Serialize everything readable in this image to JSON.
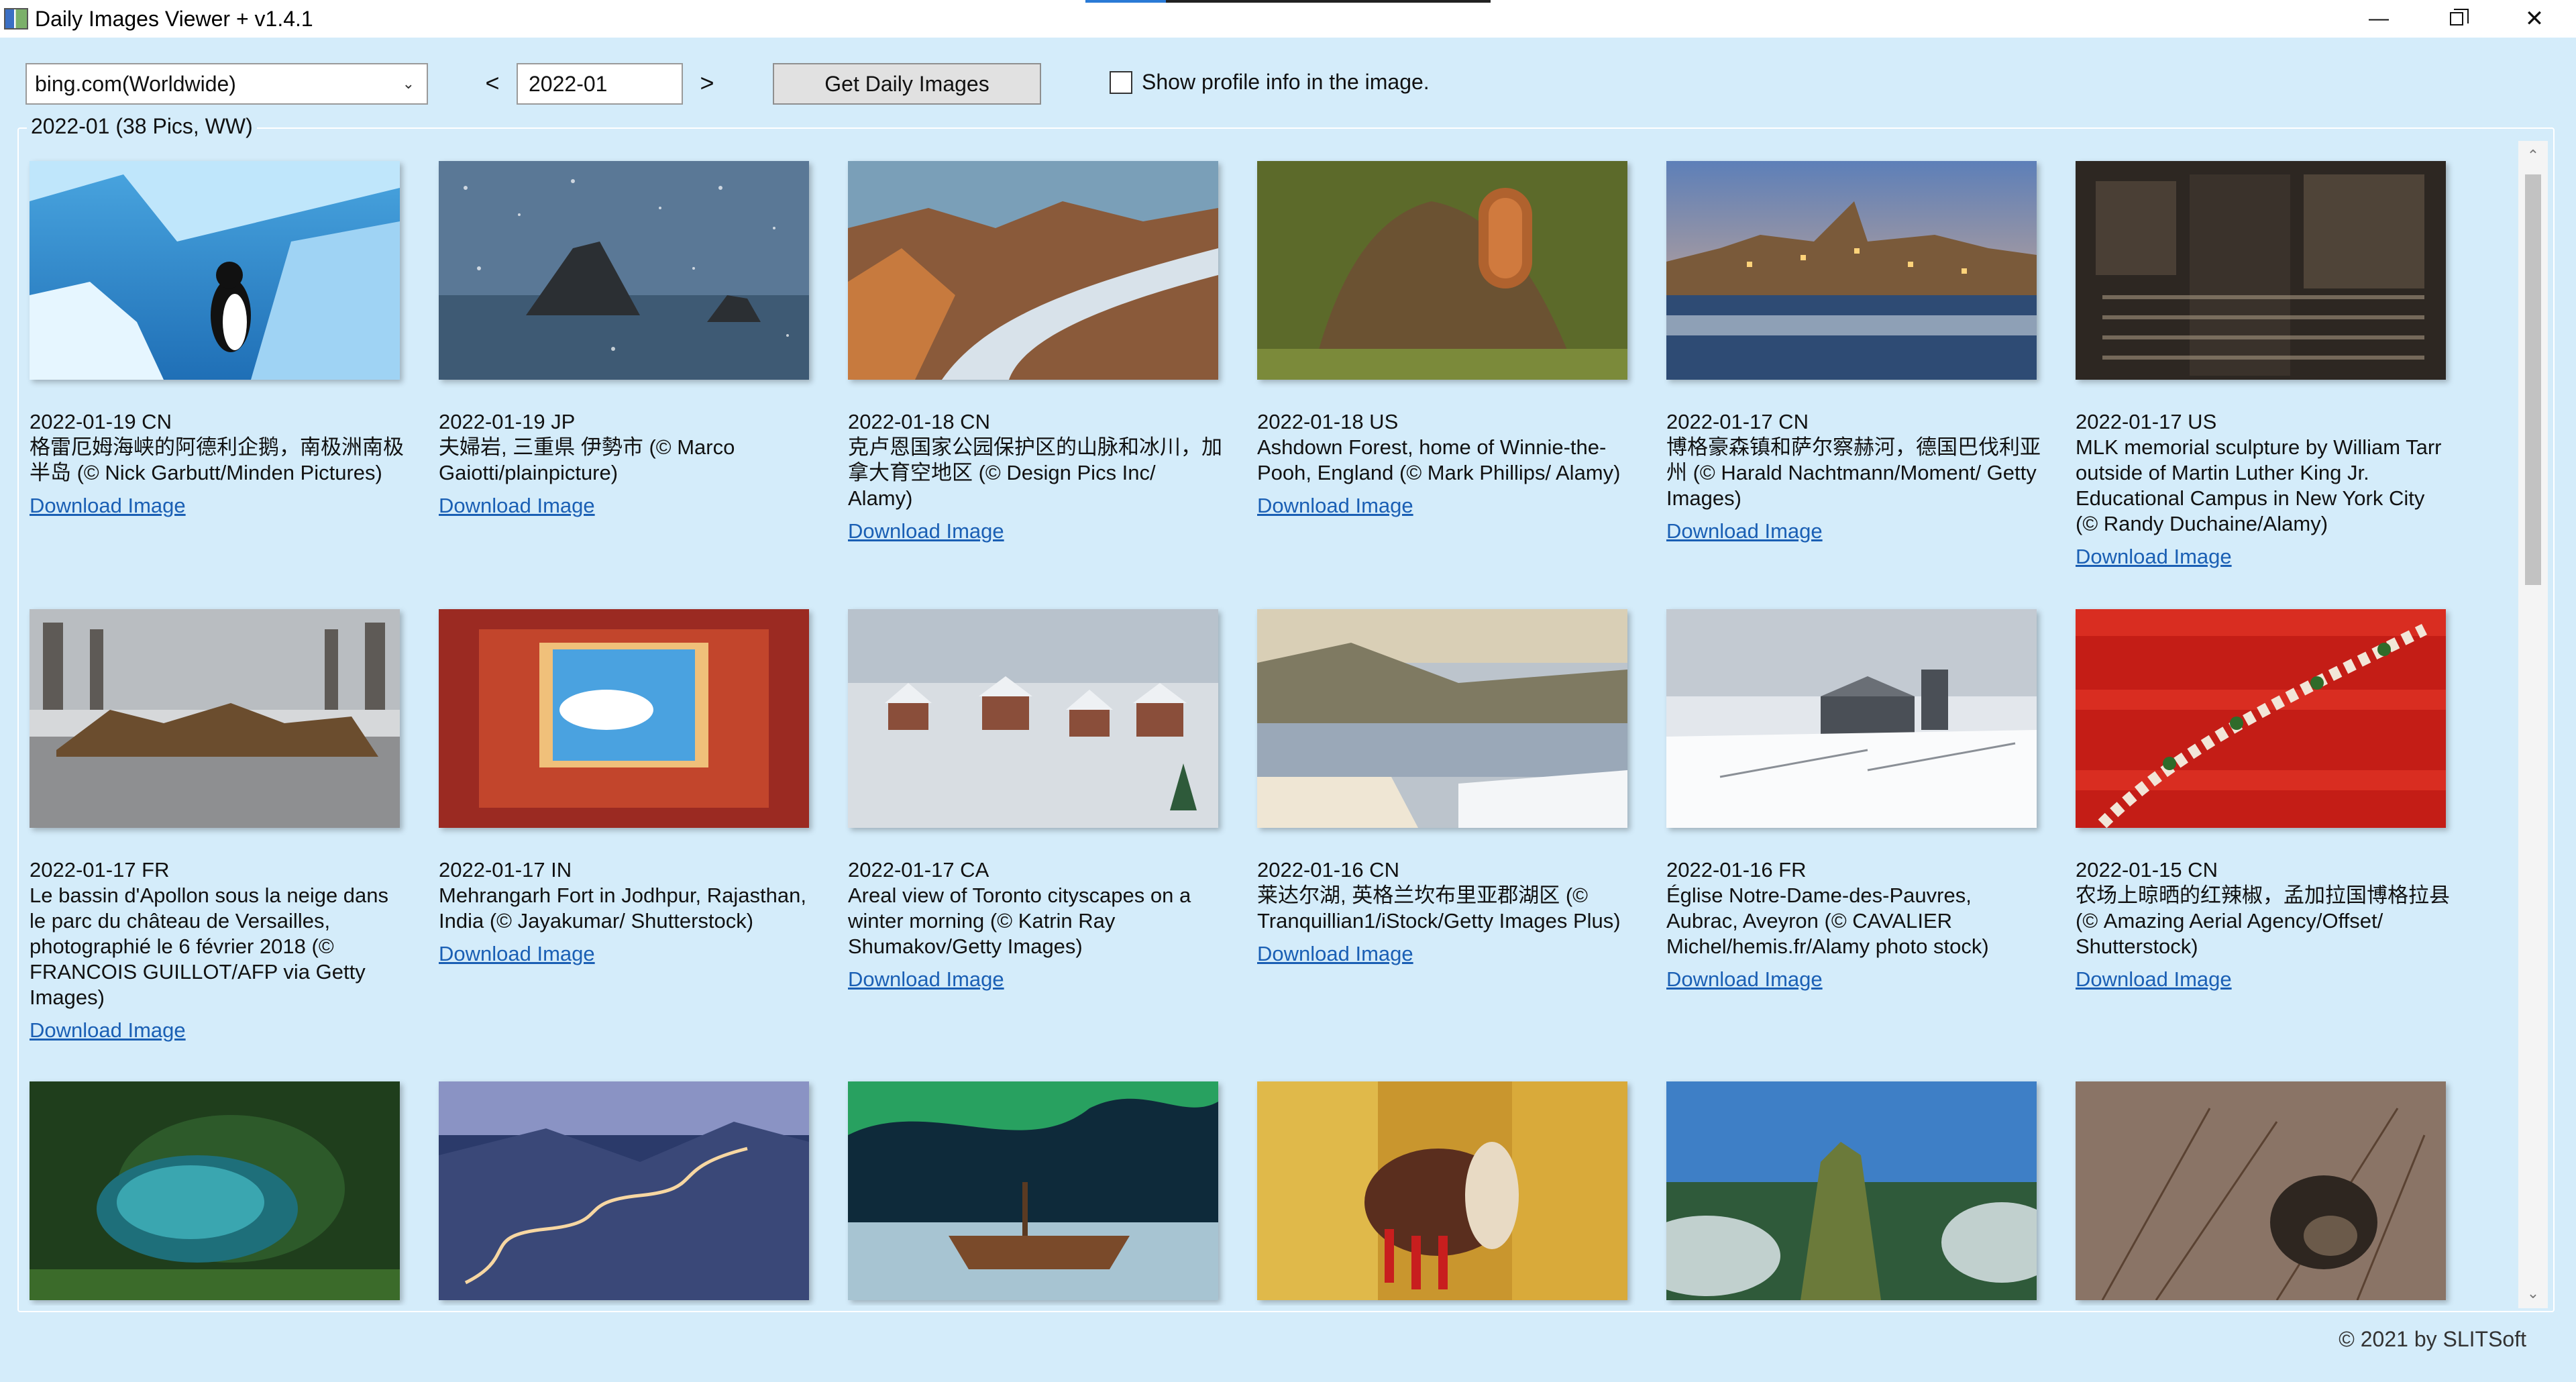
{
  "window": {
    "title": "Daily Images Viewer + v1.4.1",
    "controls": {
      "minimize": "—",
      "close": "✕"
    }
  },
  "toolbar": {
    "source_select": "bing.com(Worldwide)",
    "prev_label": "<",
    "next_label": ">",
    "month_value": "2022-01",
    "get_button": "Get Daily Images",
    "profile_checkbox_label": "Show profile info in the image.",
    "profile_checked": false
  },
  "group": {
    "legend": "2022-01 (38 Pics, WW)"
  },
  "images": [
    {
      "date": "2022-01-19 CN",
      "caption": "格雷厄姆海峡的阿德利企鹅，南极洲南极半岛 (© Nick Garbutt/Minden Pictures)",
      "link": "Download Image",
      "icon": "penguin-ice"
    },
    {
      "date": "2022-01-19 JP",
      "caption": "夫婦岩, 三重県 伊勢市 (© Marco Gaiotti/plainpicture)",
      "link": "Download Image",
      "icon": "rocks-snow"
    },
    {
      "date": "2022-01-18 CN",
      "caption": "克卢恩国家公园保护区的山脉和冰川，加拿大育空地区 (© Design Pics Inc/ Alamy)",
      "link": "Download Image",
      "icon": "glacier"
    },
    {
      "date": "2022-01-18 US",
      "caption": "Ashdown Forest, home of Winnie-the-Pooh, England (© Mark Phillips/ Alamy)",
      "link": "Download Image",
      "icon": "tree-door"
    },
    {
      "date": "2022-01-17 CN",
      "caption": "博格豪森镇和萨尔察赫河，德国巴伐利亚州 (© Harald Nachtmann/Moment/ Getty Images)",
      "link": "Download Image",
      "icon": "town-river"
    },
    {
      "date": "2022-01-17 US",
      "caption": "MLK memorial sculpture by William Tarr outside of Martin Luther King Jr. Educational Campus in New York City (© Randy Duchaine/Alamy)",
      "link": "Download Image",
      "icon": "sculpture"
    },
    {
      "date": "2022-01-17 FR",
      "caption": "Le bassin d'Apollon sous la neige dans le parc du château de Versailles, photographié le 6 février 2018 (© FRANCOIS GUILLOT/AFP via Getty Images)",
      "link": "Download Image",
      "icon": "fountain-snow"
    },
    {
      "date": "2022-01-17 IN",
      "caption": "Mehrangarh Fort in Jodhpur, Rajasthan, India (© Jayakumar/ Shutterstock)",
      "link": "Download Image",
      "icon": "fort-courtyard"
    },
    {
      "date": "2022-01-17 CA",
      "caption": "Areal view of Toronto cityscapes on a winter morning (© Katrin Ray Shumakov/Getty Images)",
      "link": "Download Image",
      "icon": "snowy-town"
    },
    {
      "date": "2022-01-16 CN",
      "caption": "莱达尔湖, 英格兰坎布里亚郡湖区 (© Tranquillian1/iStock/Getty Images Plus)",
      "link": "Download Image",
      "icon": "lake"
    },
    {
      "date": "2022-01-16 FR",
      "caption": "Église Notre-Dame-des-Pauvres, Aubrac, Aveyron (© CAVALIER Michel/hemis.fr/Alamy photo stock)",
      "link": "Download Image",
      "icon": "church-snow"
    },
    {
      "date": "2022-01-15 CN",
      "caption": "农场上晾晒的红辣椒，孟加拉国博格拉县 (© Amazing Aerial Agency/Offset/ Shutterstock)",
      "link": "Download Image",
      "icon": "red-chilies"
    },
    {
      "date": "",
      "caption": "",
      "link": "",
      "icon": "cave-pool"
    },
    {
      "date": "",
      "caption": "",
      "link": "",
      "icon": "winding-road"
    },
    {
      "date": "",
      "caption": "",
      "link": "",
      "icon": "aurora-ship"
    },
    {
      "date": "",
      "caption": "",
      "link": "",
      "icon": "drummer"
    },
    {
      "date": "",
      "caption": "",
      "link": "",
      "icon": "mountain-peak"
    },
    {
      "date": "",
      "caption": "",
      "link": "",
      "icon": "porcupine"
    }
  ],
  "footer": "© 2021 by SLITSoft"
}
